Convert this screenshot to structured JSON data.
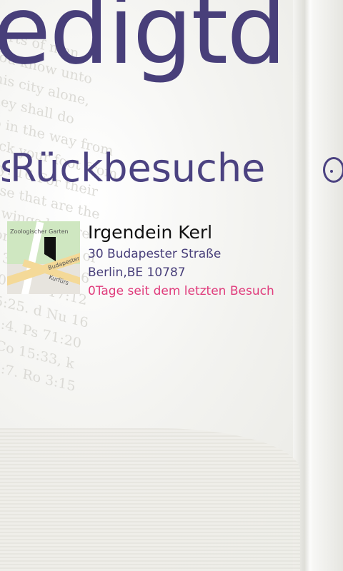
{
  "app": {
    "panorama_title": "edigtd",
    "section_header": "Rückbesuche"
  },
  "colors": {
    "accent": "#4b4281",
    "highlight": "#e03c7c"
  },
  "return_visits": [
    {
      "name": "Irgendein Kerl",
      "street": "30 Budapester Straße",
      "city_line": "Berlin,BE 10787",
      "last_visit": "0Tage seit dem letzten Besuch",
      "map_icon": "map-thumbnail",
      "map_labels": [
        "Zoologischer Garten",
        "Budapester Str",
        "Kurfürs"
      ]
    }
  ],
  "icons": {
    "more": "ellipsis-icon"
  }
}
